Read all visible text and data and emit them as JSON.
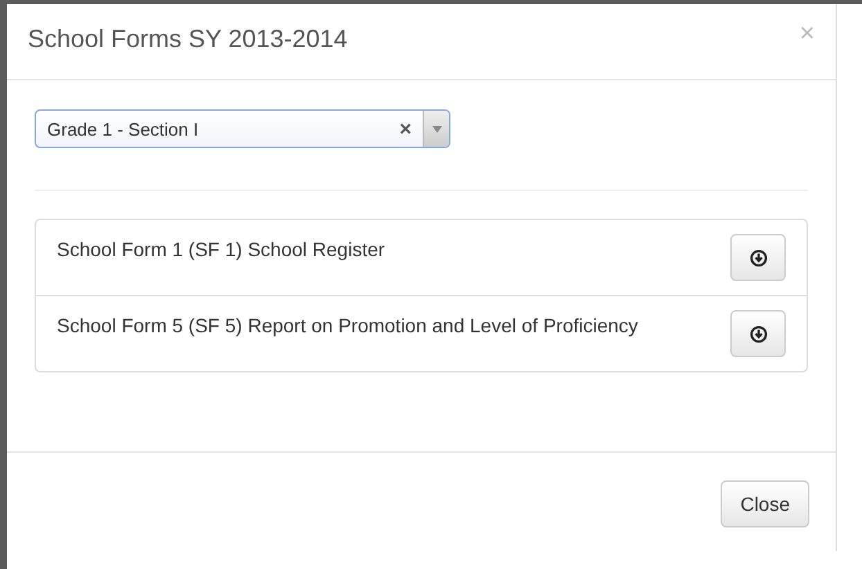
{
  "modal": {
    "title": "School Forms SY 2013-2014",
    "close_icon": "×"
  },
  "select": {
    "value": "Grade 1 - Section I",
    "clear": "×"
  },
  "forms": [
    {
      "label": "School Form 1 (SF 1) School Register"
    },
    {
      "label": "School Form 5 (SF 5) Report on Promotion and Level of Proficiency"
    }
  ],
  "buttons": [
    "Close"
  ]
}
